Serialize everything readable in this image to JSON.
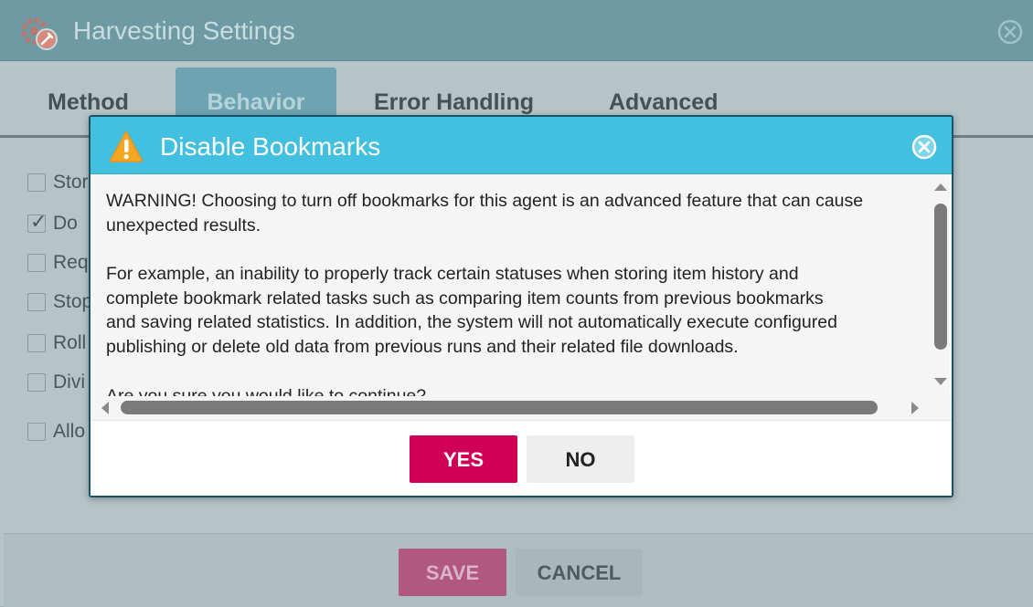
{
  "background_window": {
    "title": "Harvesting Settings",
    "tabs": [
      {
        "label": "Method"
      },
      {
        "label": "Behavior"
      },
      {
        "label": "Error Handling"
      },
      {
        "label": "Advanced"
      }
    ],
    "active_tab": "Behavior",
    "options": [
      {
        "label": "Stor",
        "checked": false
      },
      {
        "label": "Do",
        "checked": true
      },
      {
        "label": "Req",
        "checked": false
      },
      {
        "label": "Stop",
        "checked": false
      },
      {
        "label": "Roll",
        "checked": false
      },
      {
        "label": "Divi",
        "checked": false
      },
      {
        "label": "Allo",
        "checked": false
      }
    ],
    "save_label": "SAVE",
    "cancel_label": "CANCEL"
  },
  "dialog": {
    "title": "Disable Bookmarks",
    "icon": "warning-icon",
    "body": {
      "paragraph1": [
        "WARNING! Choosing to turn off bookmarks for this agent is an advanced feature that can cause",
        "unexpected results."
      ],
      "paragraph2": [
        "For example, an inability to properly track certain statuses when storing item history and",
        "complete bookmark related tasks such as comparing item counts from previous bookmarks",
        "and saving related statistics. In addition, the system will not automatically execute configured",
        "publishing or delete old data from previous runs and their related file downloads."
      ],
      "paragraph3": [
        "Are you sure you would like to continue?"
      ]
    },
    "yes_label": "YES",
    "no_label": "NO"
  },
  "colors": {
    "dialog_header": "#43bfe0",
    "yes_button": "#cf0056",
    "warning": "#f5a623",
    "bg_titlebar": "#6e9aa4"
  }
}
